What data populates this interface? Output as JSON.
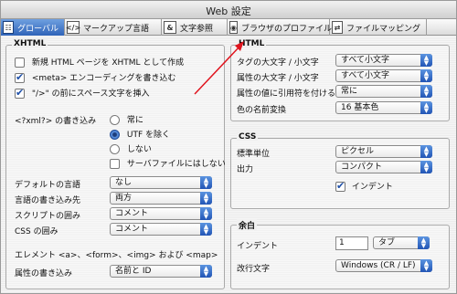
{
  "window": {
    "title": "Web 設定"
  },
  "tabs": [
    {
      "label": "グローバル",
      "icon": "global-icon"
    },
    {
      "label": "マークアップ言語",
      "icon": "markup-icon"
    },
    {
      "label": "文字参照",
      "icon": "char-ref-icon"
    },
    {
      "label": "ブラウザのプロファイル",
      "icon": "browser-profile-icon"
    },
    {
      "label": "ファイルマッピング",
      "icon": "file-mapping-icon"
    }
  ],
  "xhtml": {
    "title": "XHTML",
    "create_xhtml": "新規 HTML ページを XHTML として作成",
    "write_meta": "<meta> エンコーディングを書き込む",
    "space_before": "\"/>\" の前にスペース文字を挿入",
    "xml_label": "<?xml?> の書き込み",
    "radio_always": "常に",
    "radio_except_utf": "UTF を除く",
    "radio_never": "しない",
    "server_files": "サーバファイルにはしない",
    "default_lang_label": "デフォルトの言語",
    "default_lang_value": "なし",
    "lang_dest_label": "言語の書き込み先",
    "lang_dest_value": "両方",
    "script_wrap_label": "スクリプトの囲み",
    "script_wrap_value": "コメント",
    "css_wrap_label": "CSS の囲み",
    "css_wrap_value": "コメント",
    "elements_label": "エレメント <a>、<form>、<img> および <map>",
    "attr_write_label": "属性の書き込み",
    "attr_write_value": "名前と ID"
  },
  "html": {
    "title": "HTML",
    "tag_case_label": "タグの大文字 / 小文字",
    "tag_case_value": "すべて小文字",
    "attr_case_label": "属性の大文字 / 小文字",
    "attr_case_value": "すべて小文字",
    "quote_label": "属性の値に引用符を付ける",
    "quote_value": "常に",
    "color_name_label": "色の名前変換",
    "color_name_value": "16 基本色"
  },
  "css": {
    "title": "CSS",
    "unit_label": "標準単位",
    "unit_value": "ピクセル",
    "output_label": "出力",
    "output_value": "コンパクト",
    "indent_label": "インデント"
  },
  "margin": {
    "title": "余白",
    "indent_label": "インデント",
    "indent_value": "1",
    "indent_type": "タブ",
    "newline_label": "改行文字",
    "newline_value": "Windows (CR / LF)"
  },
  "colors": {
    "accent": "#2f63b8",
    "annotation_arrow": "#e0141e"
  }
}
